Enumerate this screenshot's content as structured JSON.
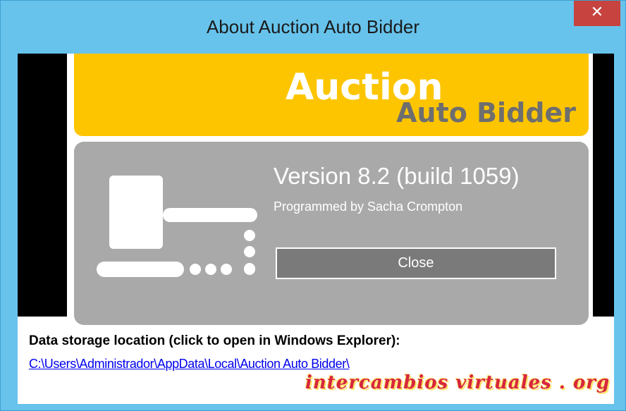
{
  "window": {
    "title": "About Auction Auto Bidder",
    "close_glyph": "✕",
    "frame_color": "#67c3ec",
    "close_color": "#c7433f"
  },
  "banner": {
    "line1": "Auction",
    "line2": "Auto Bidder",
    "color": "#fdc500"
  },
  "panel": {
    "icon": "gavel-icon",
    "version": "Version 8.2 (build 1059)",
    "programmer": "Programmed by Sacha Crompton",
    "close_label": "Close",
    "color": "#a9a9a9"
  },
  "storage": {
    "label": "Data storage location (click to open in Windows Explorer):",
    "path": "C:\\Users\\Administrador\\AppData\\Local\\Auction Auto Bidder\\"
  },
  "watermark": {
    "text": "intercambios virtuales . org"
  }
}
